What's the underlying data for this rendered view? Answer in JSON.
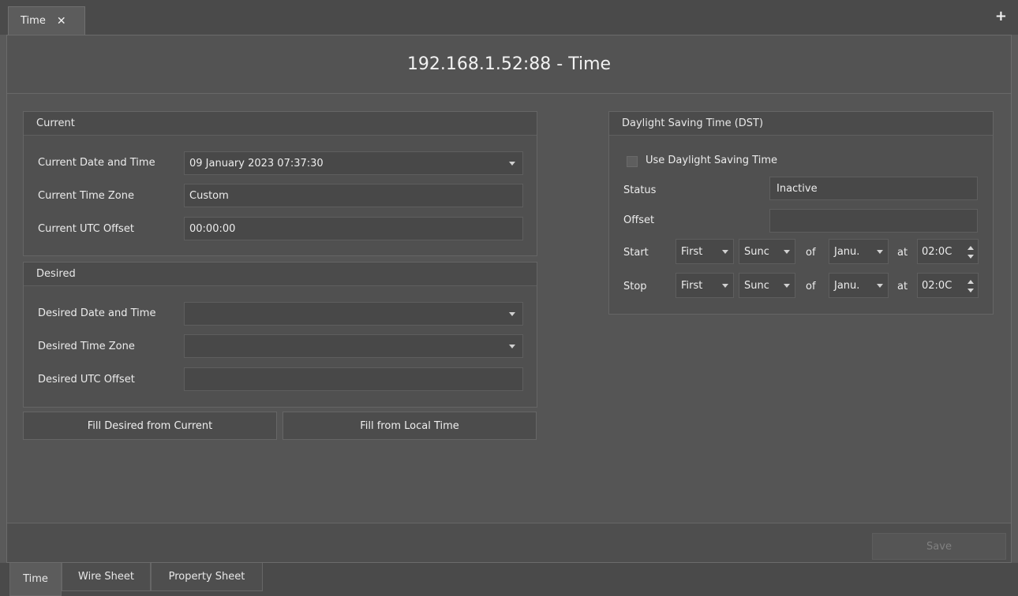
{
  "doc_tab": {
    "label": "Time",
    "close": "✕"
  },
  "new_tab": "+",
  "page_title": "192.168.1.52:88 - Time",
  "current": {
    "header": "Current",
    "date_time_label": "Current Date and Time",
    "date_time_value": "09 January 2023 07:37:30",
    "time_zone_label": "Current Time Zone",
    "time_zone_value": "Custom",
    "utc_offset_label": "Current UTC Offset",
    "utc_offset_value": "00:00:00"
  },
  "desired": {
    "header": "Desired",
    "date_time_label": "Desired Date and Time",
    "date_time_value": "",
    "time_zone_label": "Desired Time Zone",
    "time_zone_value": "",
    "utc_offset_label": "Desired UTC Offset",
    "utc_offset_value": ""
  },
  "buttons": {
    "fill_desired": "Fill Desired from Current",
    "fill_local": "Fill from Local Time",
    "save": "Save"
  },
  "dst": {
    "header": "Daylight Saving Time (DST)",
    "use_label": "Use Daylight Saving Time",
    "use_checked": false,
    "status_label": "Status",
    "status_value": "Inactive",
    "offset_label": "Offset",
    "offset_value": "",
    "of_word": "of",
    "at_word": "at",
    "start": {
      "label": "Start",
      "week": "First",
      "day": "Sunc",
      "month": "Janu.",
      "time": "02:0C"
    },
    "stop": {
      "label": "Stop",
      "week": "First",
      "day": "Sunc",
      "month": "Janu.",
      "time": "02:0C"
    }
  },
  "view_tabs": [
    "Time",
    "Wire Sheet",
    "Property Sheet"
  ]
}
